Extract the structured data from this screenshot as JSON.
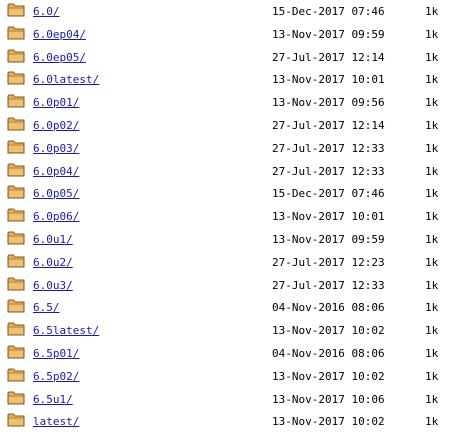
{
  "listing": {
    "rows": [
      {
        "name": "6.0/",
        "date": "15-Dec-2017 07:46",
        "size": "1k"
      },
      {
        "name": "6.0ep04/",
        "date": "13-Nov-2017 09:59",
        "size": "1k"
      },
      {
        "name": "6.0ep05/",
        "date": "27-Jul-2017 12:14",
        "size": "1k"
      },
      {
        "name": "6.0latest/",
        "date": "13-Nov-2017 10:01",
        "size": "1k"
      },
      {
        "name": "6.0p01/",
        "date": "13-Nov-2017 09:56",
        "size": "1k"
      },
      {
        "name": "6.0p02/",
        "date": "27-Jul-2017 12:14",
        "size": "1k"
      },
      {
        "name": "6.0p03/",
        "date": "27-Jul-2017 12:33",
        "size": "1k"
      },
      {
        "name": "6.0p04/",
        "date": "27-Jul-2017 12:33",
        "size": "1k"
      },
      {
        "name": "6.0p05/",
        "date": "15-Dec-2017 07:46",
        "size": "1k"
      },
      {
        "name": "6.0p06/",
        "date": "13-Nov-2017 10:01",
        "size": "1k"
      },
      {
        "name": "6.0u1/",
        "date": "13-Nov-2017 09:59",
        "size": "1k"
      },
      {
        "name": "6.0u2/",
        "date": "27-Jul-2017 12:23",
        "size": "1k"
      },
      {
        "name": "6.0u3/",
        "date": "27-Jul-2017 12:33",
        "size": "1k"
      },
      {
        "name": "6.5/",
        "date": "04-Nov-2016 08:06",
        "size": "1k"
      },
      {
        "name": "6.5latest/",
        "date": "13-Nov-2017 10:02",
        "size": "1k"
      },
      {
        "name": "6.5p01/",
        "date": "04-Nov-2016 08:06",
        "size": "1k"
      },
      {
        "name": "6.5p02/",
        "date": "13-Nov-2017 10:02",
        "size": "1k"
      },
      {
        "name": "6.5u1/",
        "date": "13-Nov-2017 10:06",
        "size": "1k"
      },
      {
        "name": "latest/",
        "date": "13-Nov-2017 10:02",
        "size": "1k"
      }
    ]
  },
  "icons": {
    "row_icon": "folder-icon"
  },
  "colors": {
    "link": "#1a1aa6",
    "folder_fill": "#e0b060",
    "folder_outline": "#8a5a1a"
  }
}
